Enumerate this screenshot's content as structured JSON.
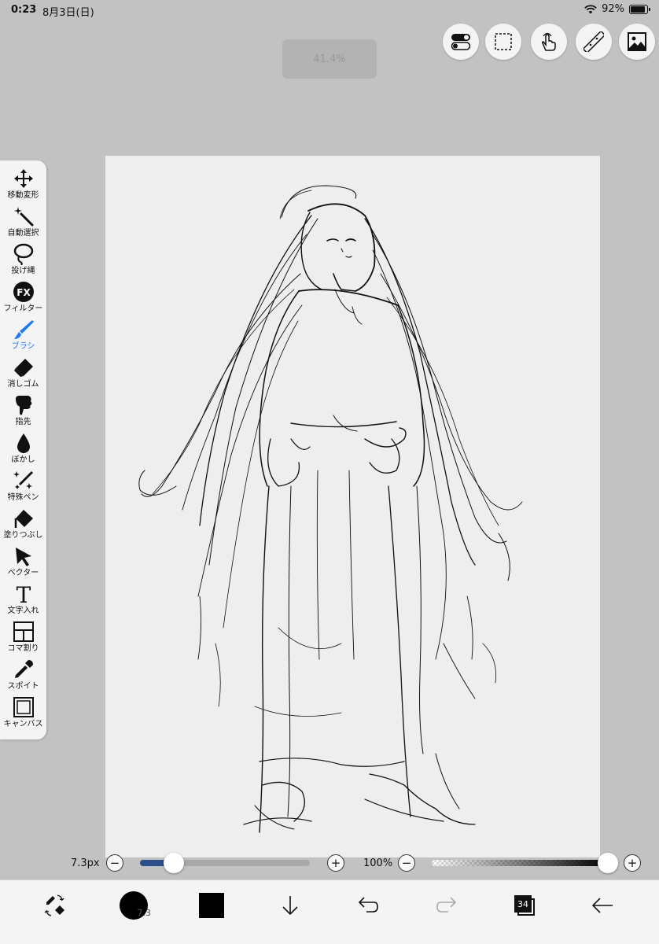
{
  "status_bar": {
    "time": "0:23",
    "date": "8月3日(日)",
    "battery": "92%",
    "battery_level": 0.92
  },
  "zoom": {
    "label": "41.4%"
  },
  "top_buttons": [
    {
      "name": "quick-toggle-icon"
    },
    {
      "name": "selection-icon"
    },
    {
      "name": "gesture-icon"
    },
    {
      "name": "ruler-icon"
    },
    {
      "name": "gallery-icon"
    }
  ],
  "tools": [
    {
      "label": "移動変形",
      "icon": "move-icon"
    },
    {
      "label": "自動選択",
      "icon": "magic-wand-icon"
    },
    {
      "label": "投げ縄",
      "icon": "lasso-icon"
    },
    {
      "label": "フィルター",
      "icon": "fx-icon",
      "glyph": "FX"
    },
    {
      "label": "ブラシ",
      "icon": "brush-icon",
      "active": true
    },
    {
      "label": "消しゴム",
      "icon": "eraser-icon"
    },
    {
      "label": "指先",
      "icon": "finger-icon"
    },
    {
      "label": "ぼかし",
      "icon": "blur-icon"
    },
    {
      "label": "特殊ペン",
      "icon": "special-pen-icon"
    },
    {
      "label": "塗りつぶし",
      "icon": "fill-icon"
    },
    {
      "label": "ベクター",
      "icon": "vector-icon"
    },
    {
      "label": "文字入れ",
      "icon": "text-icon",
      "glyph": "T"
    },
    {
      "label": "コマ割り",
      "icon": "frame-icon"
    },
    {
      "label": "スポイト",
      "icon": "eyedropper-icon"
    },
    {
      "label": "キャンバス",
      "icon": "canvas-icon"
    }
  ],
  "brush": {
    "size_label": "7.3px",
    "size_level": 0.2,
    "opacity_label": "100%",
    "opacity_level": 1.0,
    "minus": "−",
    "plus": "+"
  },
  "bottom_bar": {
    "brush_size_value": "7.3",
    "layer_count": "34",
    "colors": {
      "brush_color": "#000000",
      "accent": "#1e78ff"
    }
  }
}
